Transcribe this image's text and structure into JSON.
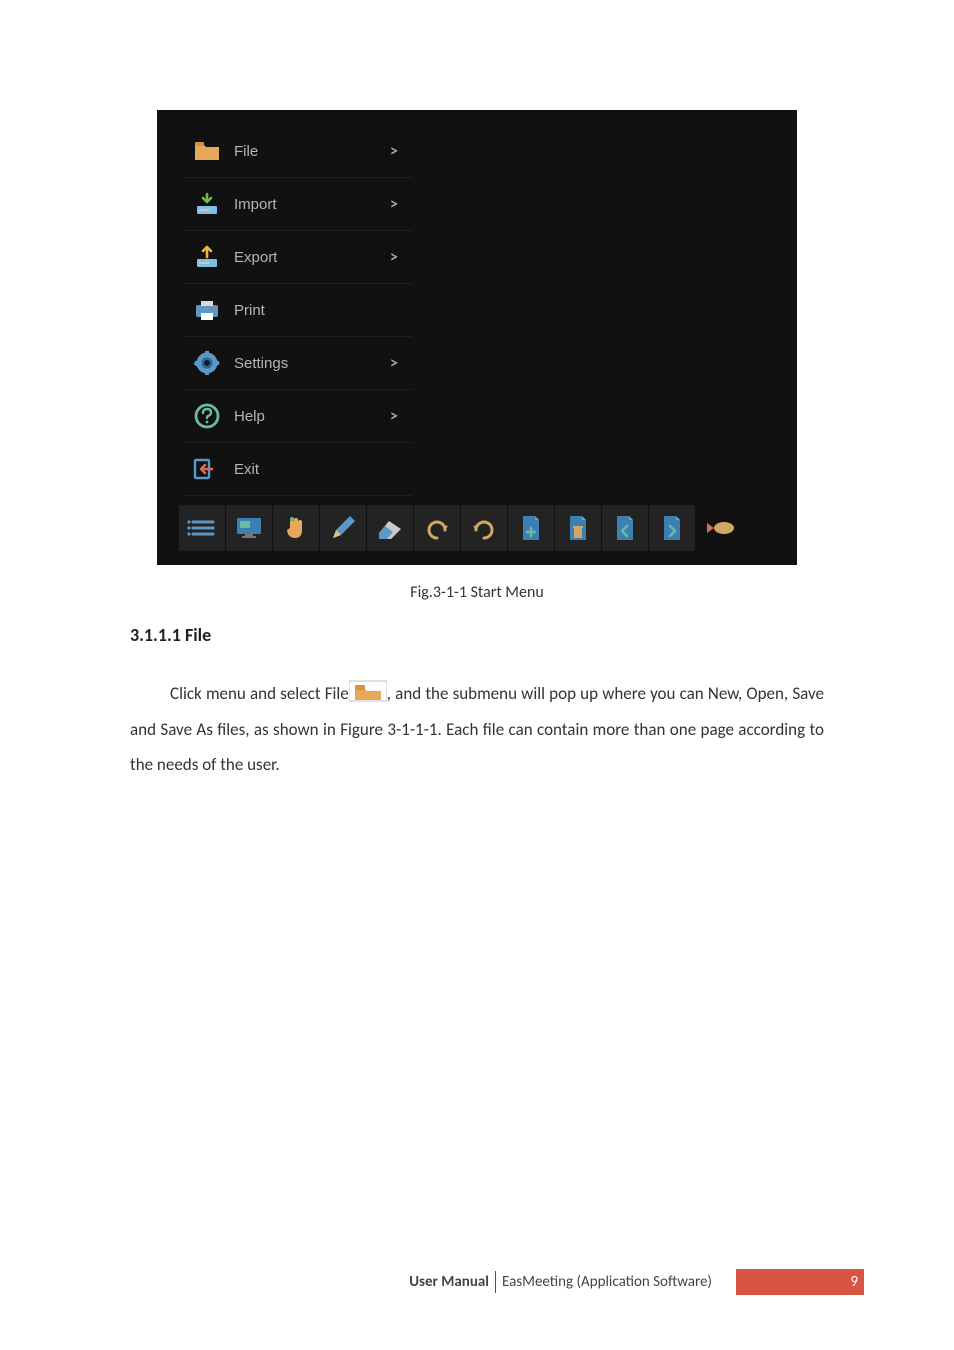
{
  "menu": {
    "items": [
      {
        "label": "File",
        "has_submenu": true
      },
      {
        "label": "Import",
        "has_submenu": true
      },
      {
        "label": "Export",
        "has_submenu": true
      },
      {
        "label": "Print",
        "has_submenu": false
      },
      {
        "label": "Settings",
        "has_submenu": true
      },
      {
        "label": "Help",
        "has_submenu": true
      },
      {
        "label": "Exit",
        "has_submenu": false
      }
    ],
    "chevron": ">"
  },
  "caption": "Fig.3-1-1 Start Menu",
  "subheading": "3.1.1.1 File",
  "paragraph": {
    "p1a": "Click menu and select File",
    "p1b": ", and the submenu will pop up where you can New, Open, Save and Save As files, as shown in Figure 3-1-1-1. Each file can contain more than one page according to the needs of the user."
  },
  "footer": {
    "manual": "User Manual",
    "product": "EasMeeting (Application Software)",
    "page": "9"
  }
}
